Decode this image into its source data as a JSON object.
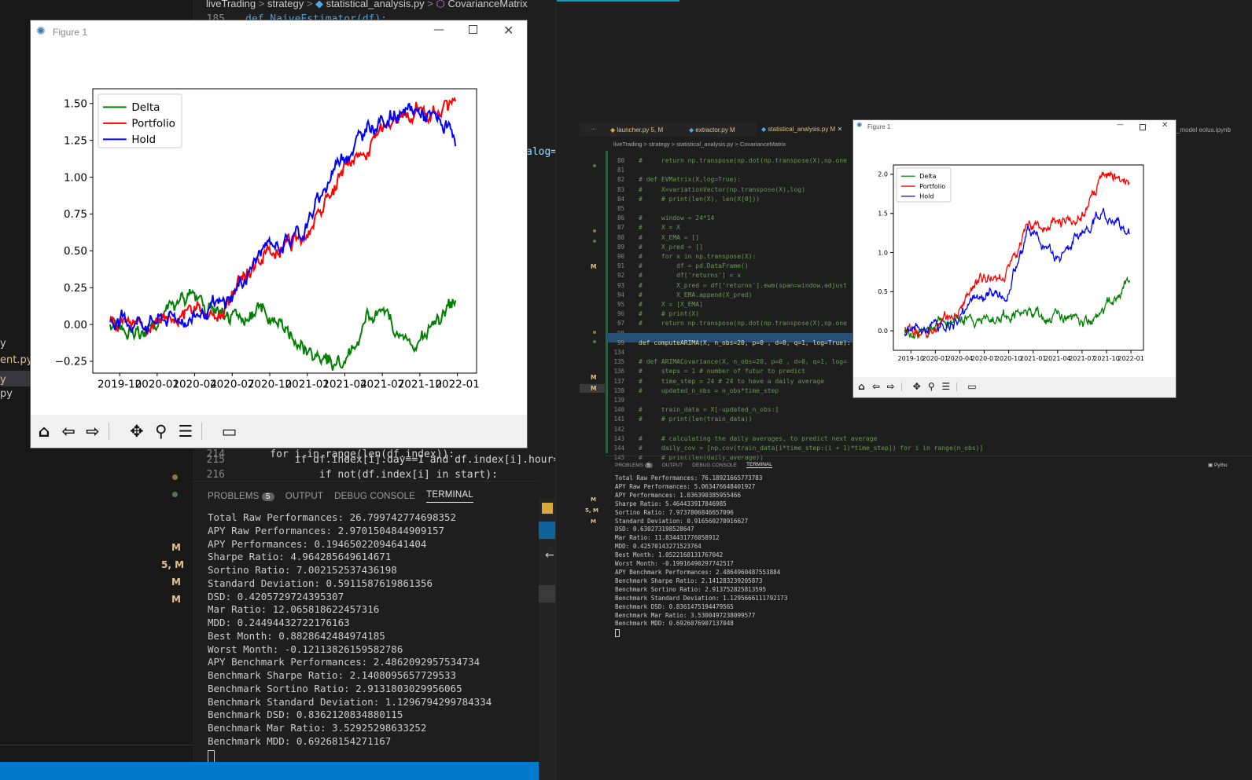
{
  "left_editor": {
    "breadcrumb": [
      "liveTrading",
      ">",
      "strategy",
      ">",
      "statistical_analysis.py",
      ">",
      "CovarianceMatrix"
    ],
    "top_line": {
      "number": "185",
      "code": "def NaiveEstimator(df):"
    },
    "partial_code": "alog=",
    "lines": [
      {
        "number": "214",
        "code": "    for i in range(len(df.index)):"
      },
      {
        "number": "215",
        "code": "        if df.index[i].day==1 and df.index[i].hour=="
      },
      {
        "number": "216",
        "code": "            if not(df.index[i] in start):"
      }
    ],
    "sidebar_files": [
      "y",
      "ent.py",
      "y",
      "py"
    ],
    "git_marks": [
      "M",
      "5, M",
      "M",
      "M"
    ]
  },
  "left_panel": {
    "tabs": [
      "PROBLEMS",
      "OUTPUT",
      "DEBUG CONSOLE",
      "TERMINAL"
    ],
    "problems_count": "5",
    "terminal": [
      "Total Raw Performances: 26.799742774698352",
      "APY Raw Performances: 2.9701504844909157",
      "APY Performances: 0.19465022094641404",
      "Sharpe Ratio: 4.964285649614671",
      "Sortino Ratio: 7.002152537436198",
      "Standard Deviation: 0.5911587619861356",
      "DSD: 0.4205729724395307",
      "Mar Ratio: 12.065818622457316",
      "MDD: 0.24494432722176163",
      "Best Month: 0.8828642484974185",
      "Worst Month: -0.12113826159582786",
      "APY Benchmark Performances: 2.4862092957534734",
      "Benchmark Sharpe Ratio: 2.1408095657729533",
      "Benchmark Sortino Ratio: 2.9131803029956065",
      "Benchmark Standard Deviation: 1.1296794299784334",
      "Benchmark DSD: 0.8362120834880115",
      "Benchmark Mar Ratio: 3.52925298633252",
      "Benchmark MDD: 0.69268154271167"
    ]
  },
  "figure1": {
    "title": "Figure 1"
  },
  "figure2": {
    "title": "Figure 1"
  },
  "right_editor": {
    "tabs": [
      {
        "label": "launcher.py",
        "badge": "5, M"
      },
      {
        "label": "extractor.py",
        "badge": "M"
      },
      {
        "label": "statistical_analysis.py",
        "badge": "M"
      }
    ],
    "tab_more": "...",
    "right_tab_partial": "_model eolus.ipynb",
    "breadcrumb": "liveTrading > strategy > statistical_analysis.py > CovarianceMatrix",
    "lines": [
      {
        "n": "80",
        "c": "#     return np.transpose(np.dot(np.transpose(X),np.one"
      },
      {
        "n": "81",
        "c": ""
      },
      {
        "n": "82",
        "c": "# def EVMatrix(X,log=True):"
      },
      {
        "n": "83",
        "c": "#     X=variationVector(np.transpose(X),log)"
      },
      {
        "n": "84",
        "c": "#     # print(len(X), len(X[0]))"
      },
      {
        "n": "85",
        "c": ""
      },
      {
        "n": "86",
        "c": "#     window = 24*14"
      },
      {
        "n": "87",
        "c": "#     X = X"
      },
      {
        "n": "88",
        "c": "#     X_EMA = []"
      },
      {
        "n": "89",
        "c": "#     X_pred = []"
      },
      {
        "n": "90",
        "c": "#     for x in np.transpose(X):"
      },
      {
        "n": "91",
        "c": "#         df = pd.DataFrame()"
      },
      {
        "n": "92",
        "c": "#         df['returns'] = x"
      },
      {
        "n": "93",
        "c": "#         X_pred = df['returns'].ewm(span=window,adjust"
      },
      {
        "n": "94",
        "c": "#         X_EMA.append(X_pred)"
      },
      {
        "n": "95",
        "c": "#     X = [X_EMA]"
      },
      {
        "n": "96",
        "c": "#     # print(X)"
      },
      {
        "n": "97",
        "c": "#     return np.transpose(np.dot(np.transpose(X),np.one"
      },
      {
        "n": "98",
        "c": ""
      },
      {
        "n": "99",
        "c": "def computeARIMA(X, n_obs=20, p=0 , d=0, q=1, log=True):"
      },
      {
        "n": "134",
        "c": ""
      },
      {
        "n": "135",
        "c": "# def ARIMACovariance(X, n_obs=20, p=0 , d=0, q=1, log="
      },
      {
        "n": "136",
        "c": "#     steps = 1 # number of futur to predict"
      },
      {
        "n": "137",
        "c": "#     time_step = 24 # 24 to have a daily average"
      },
      {
        "n": "138",
        "c": "#     updated_n_obs = n_obs*time_step"
      },
      {
        "n": "139",
        "c": ""
      },
      {
        "n": "140",
        "c": "#     train_data = X[-updated_n_obs:]"
      },
      {
        "n": "141",
        "c": "#     # print(len(train_data))"
      },
      {
        "n": "142",
        "c": ""
      },
      {
        "n": "143",
        "c": "#     # calculating the daily averages, to predict next average"
      },
      {
        "n": "144",
        "c": "#     daily_cov = [np.cov(train_data[i*time_step:(i + 1)*time_step]) for i in range(n_obs)]"
      },
      {
        "n": "145",
        "c": "#     # print(len(daily_average))"
      }
    ],
    "git_marks": [
      "M",
      "M",
      "M",
      "5, M",
      "M",
      "M"
    ],
    "panel_tabs": [
      "PROBLEMS",
      "OUTPUT",
      "DEBUG CONSOLE",
      "TERMINAL"
    ],
    "problems_count": "5",
    "python_label": "Pytho",
    "terminal": [
      "Total Raw Performances: 76.18921665773783",
      "APY Raw Performances: 5.063476648401927",
      "APY Performances: 1.036390385955466",
      "Sharpe Ratio: 5.464433917846985",
      "Sortino Ratio: 7.9737806846657096",
      "Standard Deviation: 0.916560270916627",
      "DSD: 0.630273198528647",
      "Mar Ratio: 11.834431776058912",
      "MDD: 0.42570143271523764",
      "Best Month: 1.0522168131767042",
      "Worst Month: -0.19916490297742517",
      "APY Benchmark Performances: 2.4864960487553884",
      "Benchmark Sharpe Ratio: 2.141283239205873",
      "Benchmark Sortino Ratio: 2.913752825813595",
      "Benchmark Standard Deviation: 1.1295666111792173",
      "Benchmark DSD: 0.8361475194479565",
      "Benchmark Mar Ratio: 3.5300497238099577",
      "Benchmark MDD: 0.6926076907137048"
    ]
  },
  "chart_data": [
    {
      "type": "line",
      "x": [
        "2019-10",
        "2020-01",
        "2020-04",
        "2020-07",
        "2020-10",
        "2021-01",
        "2021-04",
        "2021-07",
        "2021-10",
        "2022-01"
      ],
      "x_tick_labels": [
        "2019-10",
        "2020-01",
        "2020-04",
        "2020-07",
        "2020-10",
        "2021-01",
        "2021-04",
        "2021-07",
        "2021-10",
        "2022-01"
      ],
      "y_tick_labels": [
        "−0.25",
        "0.00",
        "0.25",
        "0.50",
        "0.75",
        "1.00",
        "1.25",
        "1.50"
      ],
      "ylim": [
        -0.33,
        1.6
      ],
      "legend": "top-left",
      "series": [
        {
          "name": "Delta",
          "color": "#008000",
          "values": [
            0.0,
            -0.03,
            0.2,
            0.02,
            0.12,
            -0.15,
            -0.27,
            0.1,
            -0.12,
            0.18
          ]
        },
        {
          "name": "Portfolio",
          "color": "#ff0000",
          "values": [
            0.0,
            0.0,
            0.07,
            0.14,
            0.47,
            0.58,
            1.0,
            1.3,
            1.46,
            1.45
          ]
        },
        {
          "name": "Hold",
          "color": "#0000ff",
          "values": [
            0.0,
            0.03,
            0.05,
            0.13,
            0.52,
            0.61,
            1.15,
            1.38,
            1.45,
            1.3
          ]
        }
      ]
    },
    {
      "type": "line",
      "x": [
        "2019-10",
        "2020-01",
        "2020-04",
        "2020-07",
        "2020-10",
        "2021-01",
        "2021-04",
        "2021-07",
        "2021-10",
        "2022-01"
      ],
      "x_tick_labels": [
        "2019-10",
        "2020-01",
        "2020-04",
        "2020-07",
        "2020-10",
        "2021-01",
        "2021-04",
        "2021-07",
        "2021-10",
        "2022-01"
      ],
      "y_tick_labels": [
        "0.0",
        "0.5",
        "1.0",
        "1.5",
        "2.0"
      ],
      "ylim": [
        -0.25,
        2.12
      ],
      "legend": "top-left",
      "series": [
        {
          "name": "Delta",
          "color": "#008000",
          "values": [
            0.0,
            -0.03,
            0.18,
            0.12,
            0.2,
            0.25,
            0.2,
            0.1,
            0.3,
            0.62
          ]
        },
        {
          "name": "Portfolio",
          "color": "#ff0000",
          "values": [
            0.0,
            0.02,
            0.22,
            0.62,
            0.72,
            1.3,
            1.35,
            1.4,
            2.0,
            1.9
          ]
        },
        {
          "name": "Hold",
          "color": "#0000ff",
          "values": [
            0.0,
            0.04,
            0.1,
            0.5,
            0.42,
            1.3,
            0.95,
            1.25,
            1.5,
            1.3
          ]
        }
      ]
    }
  ]
}
